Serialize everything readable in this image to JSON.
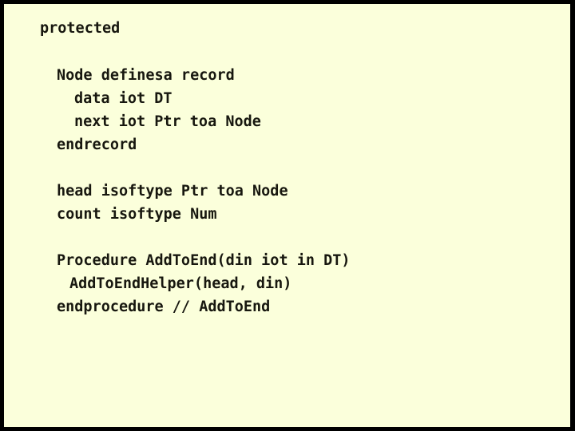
{
  "slide": {
    "background_color": "#fbffdb",
    "border_color": "#000000",
    "text_color": "#17170f",
    "heading": "protected",
    "code_lines": [
      {
        "text": "Node definesa record",
        "indent": 0
      },
      {
        "text": "data iot DT",
        "indent": 1
      },
      {
        "text": "next iot Ptr toa Node",
        "indent": 1
      },
      {
        "text": "endrecord",
        "indent": 0
      },
      {
        "text": "head isoftype Ptr toa Node",
        "indent": 0
      },
      {
        "text": "count isoftype Num",
        "indent": 0
      },
      {
        "text": "Procedure AddToEnd(din iot in DT)",
        "indent": 0
      },
      {
        "text": "AddToEndHelper(head, din)",
        "indent": 1
      },
      {
        "text": "endprocedure // AddToEnd",
        "indent": 0
      }
    ]
  }
}
